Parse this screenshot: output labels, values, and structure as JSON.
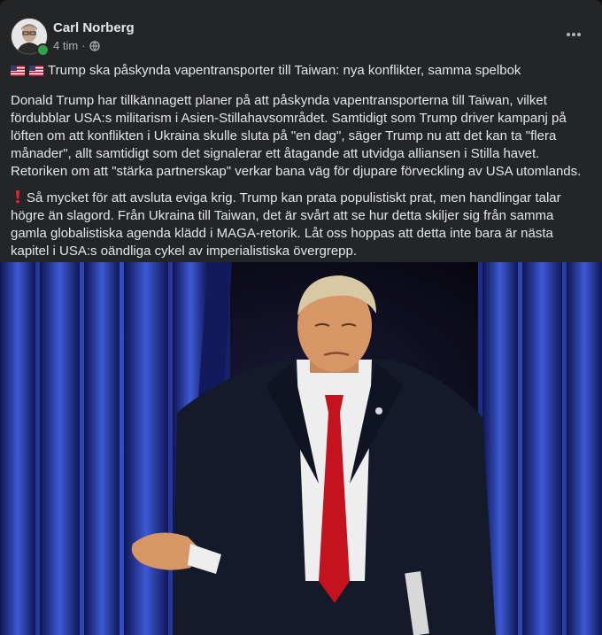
{
  "post": {
    "author": "Carl Norberg",
    "time": "4 tim",
    "separator": "·",
    "more_icon": "more-options-icon",
    "headline": "Trump ska påskynda vapentransporter till Taiwan: nya konflikter, samma spelbok",
    "paragraph1": "Donald Trump har tillkännagett planer på att påskynda vapentransporterna till Taiwan, vilket fördubblar USA:s militarism i Asien-Stillahavsområdet. Samtidigt som Trump driver kampanj på löften om att konflikten i Ukraina skulle sluta på \"en dag\", säger Trump nu att det kan ta \"flera månader\", allt samtidigt som det signalerar ett åtagande att utvidga alliansen i Stilla havet. Retoriken om att \"stärka partnerskap\" verkar bana väg för djupare förveckling av USA utomlands.",
    "paragraph2": "Så mycket för att avsluta eviga krig. Trump kan prata populistiskt prat, men handlingar talar högre än slagord. Från Ukraina till Taiwan, det är svårt att se hur detta skiljer sig från samma gamla globalistiska agenda klädd i MAGA-retorik. Låt oss hoppas att detta inte bara är nästa kapitel i USA:s oändliga cykel av imperialistiska övergrepp."
  },
  "colors": {
    "background": "#242526",
    "text": "#e4e6eb",
    "secondary": "#b0b3b8",
    "online": "#31a24c",
    "curtain": "#2a3fae"
  }
}
